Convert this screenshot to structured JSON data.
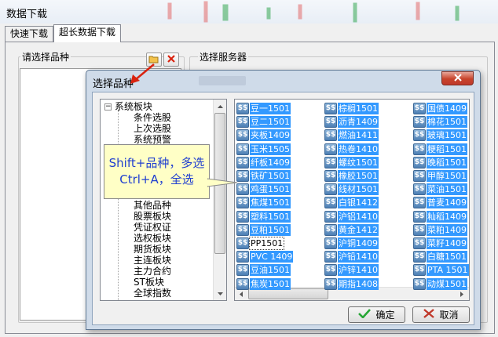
{
  "window": {
    "title": "数据下载"
  },
  "tabs": [
    {
      "label": "快速下载",
      "active": false
    },
    {
      "label": "超长数据下载",
      "active": true
    }
  ],
  "left_group": {
    "label": "请选择品种"
  },
  "right_group": {
    "label": "选择服务器"
  },
  "dialog": {
    "title": "选择品种",
    "tree": {
      "root": "系统板块",
      "items": [
        "条件选股",
        "上次选股",
        "系统预警",
        "其他品种",
        "股票板块",
        "凭证权证",
        "选权板块",
        "期货板块",
        "主连板块",
        "主力合约",
        "ST板块",
        "全球指数"
      ]
    },
    "products": {
      "col1": [
        "豆一1501",
        "豆二1501",
        "夹板1409",
        "玉米1505",
        "纤板1409",
        "铁矿1501",
        "鸡蛋1501",
        "焦煤1501",
        "塑料1501",
        "豆粕1501",
        "PP1501",
        "PVC 1409",
        "豆油1501",
        "焦炭1501"
      ],
      "col2": [
        "棕榈1501",
        "沥青1409",
        "燃油1411",
        "热卷1410",
        "螺纹1501",
        "橡胶1501",
        "线材1501",
        "白银1412",
        "沪铝1410",
        "黄金1412",
        "沪铜1409",
        "沪铅1410",
        "沪锌1410",
        "期指1408"
      ],
      "col3": [
        "国债1409",
        "棉花1501",
        "玻璃1501",
        "粳稻1501",
        "晚稻1501",
        "甲醇1501",
        "菜油1501",
        "普麦1409",
        "籼稻1409",
        "菜粕1409",
        "菜籽1409",
        "白糖1501",
        "PTA 1501",
        "动煤1501"
      ],
      "icon_text": "$$",
      "unselected_index": 10
    },
    "ok_label": "确定",
    "cancel_label": "取消"
  },
  "callout": {
    "line1": "Shift+品种，多选",
    "line2": "Ctrl+A，全选"
  },
  "colors": {
    "selection": "#3399ff",
    "callout_bg": "#ffffc6",
    "callout_text": "#1f3fd0",
    "arrow": "#d9230f"
  }
}
